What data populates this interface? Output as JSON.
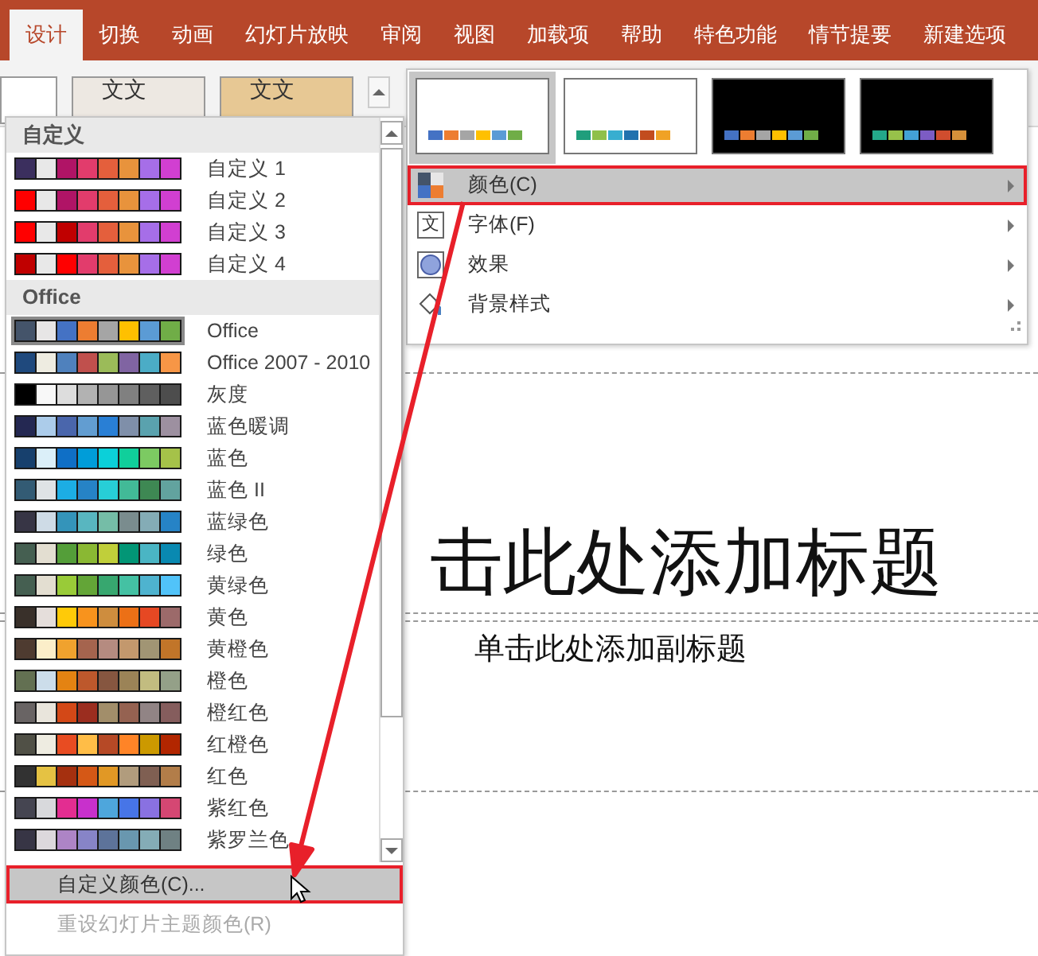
{
  "tabs": [
    {
      "label": "设计",
      "selected": true
    },
    {
      "label": "切换",
      "selected": false
    },
    {
      "label": "动画",
      "selected": false
    },
    {
      "label": "幻灯片放映",
      "selected": false
    },
    {
      "label": "审阅",
      "selected": false
    },
    {
      "label": "视图",
      "selected": false
    },
    {
      "label": "加载项",
      "selected": false
    },
    {
      "label": "帮助",
      "selected": false
    },
    {
      "label": "特色功能",
      "selected": false
    },
    {
      "label": "情节提要",
      "selected": false
    },
    {
      "label": "新建选项",
      "selected": false
    }
  ],
  "theme_gallery": [
    {
      "kind": "plain"
    },
    {
      "kind": "paper",
      "text": "文文"
    },
    {
      "kind": "wood",
      "text": "文文"
    }
  ],
  "color_menu": {
    "groups": [
      {
        "title": "自定义",
        "schemes": [
          {
            "name": "自定义 1",
            "selected": false,
            "swatches": [
              {
                "color": "#3b2f5e"
              },
              {
                "color": "#e8e8e8"
              },
              {
                "color": "#b01466"
              },
              {
                "color": "#e23c6c"
              },
              {
                "color": "#e45f3c"
              },
              {
                "color": "#e8933c"
              },
              {
                "color": "#a66ee8"
              },
              {
                "color": "#d13fd1"
              }
            ]
          },
          {
            "name": "自定义 2",
            "selected": false,
            "swatches": [
              {
                "color": "#ff0000"
              },
              {
                "color": "#e8e8e8"
              },
              {
                "color": "#b01466"
              },
              {
                "color": "#e23c6c"
              },
              {
                "color": "#e45f3c"
              },
              {
                "color": "#e8933c"
              },
              {
                "color": "#a66ee8"
              },
              {
                "color": "#d13fd1"
              }
            ]
          },
          {
            "name": "自定义 3",
            "selected": false,
            "swatches": [
              {
                "color": "#ff0000"
              },
              {
                "color": "#e8e8e8"
              },
              {
                "color": "#c00000"
              },
              {
                "color": "#e23c6c"
              },
              {
                "color": "#e45f3c"
              },
              {
                "color": "#e8933c"
              },
              {
                "color": "#a66ee8"
              },
              {
                "color": "#d13fd1"
              }
            ]
          },
          {
            "name": "自定义 4",
            "selected": false,
            "swatches": [
              {
                "color": "#c00000"
              },
              {
                "color": "#e8e8e8"
              },
              {
                "color": "#ff0000"
              },
              {
                "color": "#e23c6c"
              },
              {
                "color": "#e45f3c"
              },
              {
                "color": "#e8933c"
              },
              {
                "color": "#a66ee8"
              },
              {
                "color": "#d13fd1"
              }
            ]
          }
        ]
      },
      {
        "title": "Office",
        "schemes": [
          {
            "name": "Office",
            "selected": true,
            "swatches": [
              {
                "color": "#44546a"
              },
              {
                "color": "#e7e6e6"
              },
              {
                "color": "#4472c4"
              },
              {
                "color": "#ed7d31"
              },
              {
                "color": "#a5a5a5"
              },
              {
                "color": "#ffc000"
              },
              {
                "color": "#5b9bd5"
              },
              {
                "color": "#70ad47"
              }
            ]
          },
          {
            "name": "Office 2007 - 2010",
            "selected": false,
            "swatches": [
              {
                "color": "#1f497d"
              },
              {
                "color": "#eeece1"
              },
              {
                "color": "#4f81bd"
              },
              {
                "color": "#c0504d"
              },
              {
                "color": "#9bbb59"
              },
              {
                "color": "#8064a2"
              },
              {
                "color": "#4bacc6"
              },
              {
                "color": "#f79646"
              }
            ]
          },
          {
            "name": "灰度",
            "selected": false,
            "swatches": [
              {
                "color": "#000000"
              },
              {
                "color": "#f8f8f8"
              },
              {
                "color": "#dddddd"
              },
              {
                "color": "#b2b2b2"
              },
              {
                "color": "#969696"
              },
              {
                "color": "#808080"
              },
              {
                "color": "#5f5f5f"
              },
              {
                "color": "#4d4d4d"
              }
            ]
          },
          {
            "name": "蓝色暖调",
            "selected": false,
            "swatches": [
              {
                "color": "#242852"
              },
              {
                "color": "#acccea"
              },
              {
                "color": "#4a66ac"
              },
              {
                "color": "#629dd1"
              },
              {
                "color": "#297fd5"
              },
              {
                "color": "#7f8fa9"
              },
              {
                "color": "#5aa2ae"
              },
              {
                "color": "#9d90a0"
              }
            ]
          },
          {
            "name": "蓝色",
            "selected": false,
            "swatches": [
              {
                "color": "#17406d"
              },
              {
                "color": "#dbeff9"
              },
              {
                "color": "#0f6fc6"
              },
              {
                "color": "#009dd9"
              },
              {
                "color": "#0bd0d9"
              },
              {
                "color": "#10cf9b"
              },
              {
                "color": "#7cca62"
              },
              {
                "color": "#a5c249"
              }
            ]
          },
          {
            "name": "蓝色 II",
            "selected": false,
            "swatches": [
              {
                "color": "#335b74"
              },
              {
                "color": "#dfe3e5"
              },
              {
                "color": "#1cade4"
              },
              {
                "color": "#2683c6"
              },
              {
                "color": "#27ced7"
              },
              {
                "color": "#42ba97"
              },
              {
                "color": "#3e8853"
              },
              {
                "color": "#62a39f"
              }
            ]
          },
          {
            "name": "蓝绿色",
            "selected": false,
            "swatches": [
              {
                "color": "#373545"
              },
              {
                "color": "#cedbe6"
              },
              {
                "color": "#3494ba"
              },
              {
                "color": "#58b6c0"
              },
              {
                "color": "#75bda7"
              },
              {
                "color": "#7a8c8e"
              },
              {
                "color": "#84acb6"
              },
              {
                "color": "#2683c6"
              }
            ]
          },
          {
            "name": "绿色",
            "selected": false,
            "swatches": [
              {
                "color": "#455f51"
              },
              {
                "color": "#e3ded1"
              },
              {
                "color": "#549e39"
              },
              {
                "color": "#8ab833"
              },
              {
                "color": "#c0cf3a"
              },
              {
                "color": "#029676"
              },
              {
                "color": "#4ab5c4"
              },
              {
                "color": "#0989b1"
              }
            ]
          },
          {
            "name": "黄绿色",
            "selected": false,
            "swatches": [
              {
                "color": "#455f51"
              },
              {
                "color": "#e3ded1"
              },
              {
                "color": "#99cb38"
              },
              {
                "color": "#63a537"
              },
              {
                "color": "#37a76f"
              },
              {
                "color": "#44c1a3"
              },
              {
                "color": "#4eb3cf"
              },
              {
                "color": "#51c3f9"
              }
            ]
          },
          {
            "name": "黄色",
            "selected": false,
            "swatches": [
              {
                "color": "#39302a"
              },
              {
                "color": "#e5dedb"
              },
              {
                "color": "#ffca08"
              },
              {
                "color": "#f8931d"
              },
              {
                "color": "#ce8d3e"
              },
              {
                "color": "#ec7016"
              },
              {
                "color": "#e64823"
              },
              {
                "color": "#9c6a6a"
              }
            ]
          },
          {
            "name": "黄橙色",
            "selected": false,
            "swatches": [
              {
                "color": "#4e3b30"
              },
              {
                "color": "#fbeec9"
              },
              {
                "color": "#f0a22e"
              },
              {
                "color": "#a5644e"
              },
              {
                "color": "#b58b80"
              },
              {
                "color": "#c3986d"
              },
              {
                "color": "#a19574"
              },
              {
                "color": "#c17529"
              }
            ]
          },
          {
            "name": "橙色",
            "selected": false,
            "swatches": [
              {
                "color": "#637052"
              },
              {
                "color": "#ccddea"
              },
              {
                "color": "#e48312"
              },
              {
                "color": "#bd582c"
              },
              {
                "color": "#865640"
              },
              {
                "color": "#9b8357"
              },
              {
                "color": "#c2bc80"
              },
              {
                "color": "#94a088"
              }
            ]
          },
          {
            "name": "橙红色",
            "selected": false,
            "swatches": [
              {
                "color": "#696464"
              },
              {
                "color": "#e9e5dc"
              },
              {
                "color": "#d34817"
              },
              {
                "color": "#9b2d1f"
              },
              {
                "color": "#a28e6a"
              },
              {
                "color": "#956251"
              },
              {
                "color": "#918485"
              },
              {
                "color": "#855d5d"
              }
            ]
          },
          {
            "name": "红橙色",
            "selected": false,
            "swatches": [
              {
                "color": "#505046"
              },
              {
                "color": "#eeece1"
              },
              {
                "color": "#e84c22"
              },
              {
                "color": "#ffbd47"
              },
              {
                "color": "#b64926"
              },
              {
                "color": "#ff8427"
              },
              {
                "color": "#cc9900"
              },
              {
                "color": "#b22600"
              }
            ]
          },
          {
            "name": "红色",
            "selected": false,
            "swatches": [
              {
                "color": "#323232"
              },
              {
                "color": "#e5c243"
              },
              {
                "color": "#a5300f"
              },
              {
                "color": "#d55816"
              },
              {
                "color": "#e19825"
              },
              {
                "color": "#b19c7d"
              },
              {
                "color": "#7f5f52"
              },
              {
                "color": "#b27d49"
              }
            ]
          },
          {
            "name": "紫红色",
            "selected": false,
            "swatches": [
              {
                "color": "#454551"
              },
              {
                "color": "#d8d9dc"
              },
              {
                "color": "#e32d91"
              },
              {
                "color": "#c830cc"
              },
              {
                "color": "#4ea6dc"
              },
              {
                "color": "#4775e7"
              },
              {
                "color": "#8971e1"
              },
              {
                "color": "#d54773"
              }
            ]
          },
          {
            "name": "紫罗兰色",
            "selected": false,
            "swatches": [
              {
                "color": "#373545"
              },
              {
                "color": "#dcd8dc"
              },
              {
                "color": "#ad84c6"
              },
              {
                "color": "#8784c7"
              },
              {
                "color": "#5d739a"
              },
              {
                "color": "#6997af"
              },
              {
                "color": "#84acb6"
              },
              {
                "color": "#6f8183"
              }
            ]
          }
        ]
      }
    ],
    "commands": [
      {
        "label": "自定义颜色(C)...",
        "highlighted": true,
        "disabled": false,
        "annotated": true
      },
      {
        "label": "重设幻灯片主题颜色(R)",
        "highlighted": false,
        "disabled": true,
        "annotated": false
      }
    ]
  },
  "variants": {
    "thumbnails": [
      {
        "kind": "light",
        "selected": true,
        "swatches": [
          {
            "color": "#4472c4"
          },
          {
            "color": "#ed7d31"
          },
          {
            "color": "#a5a5a5"
          },
          {
            "color": "#ffc000"
          },
          {
            "color": "#5b9bd5"
          },
          {
            "color": "#70ad47"
          }
        ]
      },
      {
        "kind": "light",
        "selected": false,
        "swatches": [
          {
            "color": "#1f9e7c"
          },
          {
            "color": "#8fc04a"
          },
          {
            "color": "#38aed0"
          },
          {
            "color": "#2072ae"
          },
          {
            "color": "#c24c1e"
          },
          {
            "color": "#f0a225"
          }
        ]
      },
      {
        "kind": "dark",
        "selected": false,
        "swatches": [
          {
            "color": "#4472c4"
          },
          {
            "color": "#ed7d31"
          },
          {
            "color": "#a5a5a5"
          },
          {
            "color": "#ffc000"
          },
          {
            "color": "#5b9bd5"
          },
          {
            "color": "#70ad47"
          }
        ]
      },
      {
        "kind": "dark",
        "selected": false,
        "swatches": [
          {
            "color": "#24a88a"
          },
          {
            "color": "#97c14a"
          },
          {
            "color": "#43a2d6"
          },
          {
            "color": "#7c5cc4"
          },
          {
            "color": "#d04d2e"
          },
          {
            "color": "#d6903a"
          }
        ]
      }
    ],
    "menu": [
      {
        "kind": "colors",
        "label": "颜色(C)",
        "highlighted": true,
        "annotated": true
      },
      {
        "kind": "fonts",
        "label": "字体(F)",
        "icon_glyph": "文",
        "highlighted": false,
        "annotated": false
      },
      {
        "kind": "effects",
        "label": "效果",
        "highlighted": false,
        "annotated": false
      },
      {
        "kind": "background",
        "label": "背景样式",
        "highlighted": false,
        "annotated": false
      }
    ]
  },
  "slide": {
    "title": "击此处添加标题",
    "subtitle": "单击此处添加副标题"
  }
}
